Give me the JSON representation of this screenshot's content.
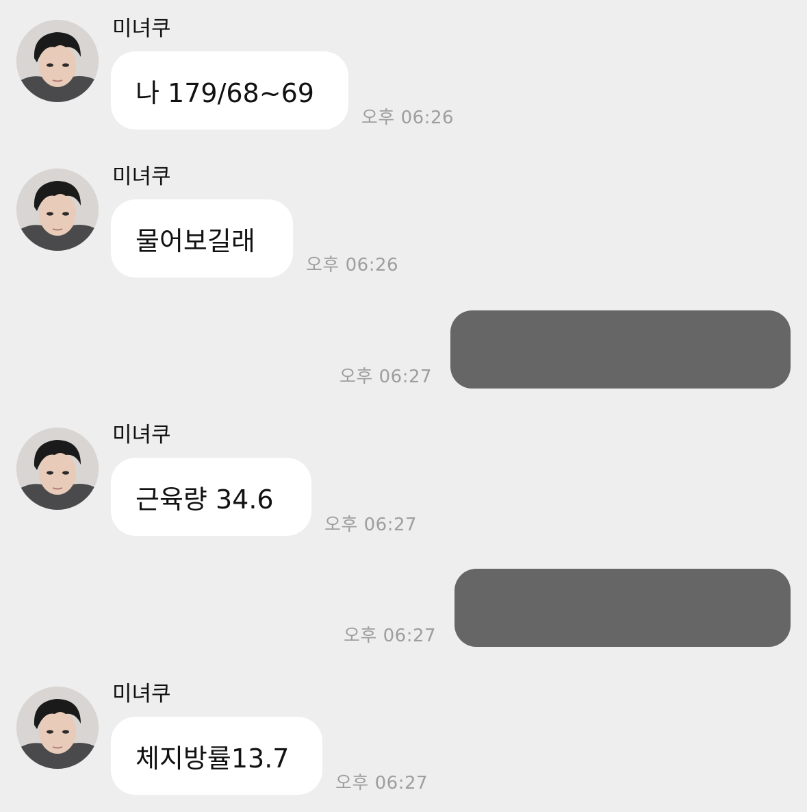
{
  "chat": {
    "messages": [
      {
        "direction": "in",
        "sender": "미녀쿠",
        "text": "나 179/68~69",
        "time": "오후 06:26"
      },
      {
        "direction": "in",
        "sender": "미녀쿠",
        "text": "물어보길래",
        "time": "오후 06:26"
      },
      {
        "direction": "out",
        "text": "",
        "time": "오후 06:27"
      },
      {
        "direction": "in",
        "sender": "미녀쿠",
        "text": "근육량 34.6",
        "time": "오후 06:27"
      },
      {
        "direction": "out",
        "text": "",
        "time": "오후 06:27"
      },
      {
        "direction": "in",
        "sender": "미녀쿠",
        "text": "체지방률13.7",
        "time": "오후 06:27"
      }
    ]
  },
  "colors": {
    "background": "#eeeeee",
    "incoming_bubble": "#ffffff",
    "outgoing_bubble_redacted": "#666666",
    "timestamp": "#9e9e9e"
  },
  "icons": {
    "avatar": "profile-photo-avatar-icon"
  }
}
